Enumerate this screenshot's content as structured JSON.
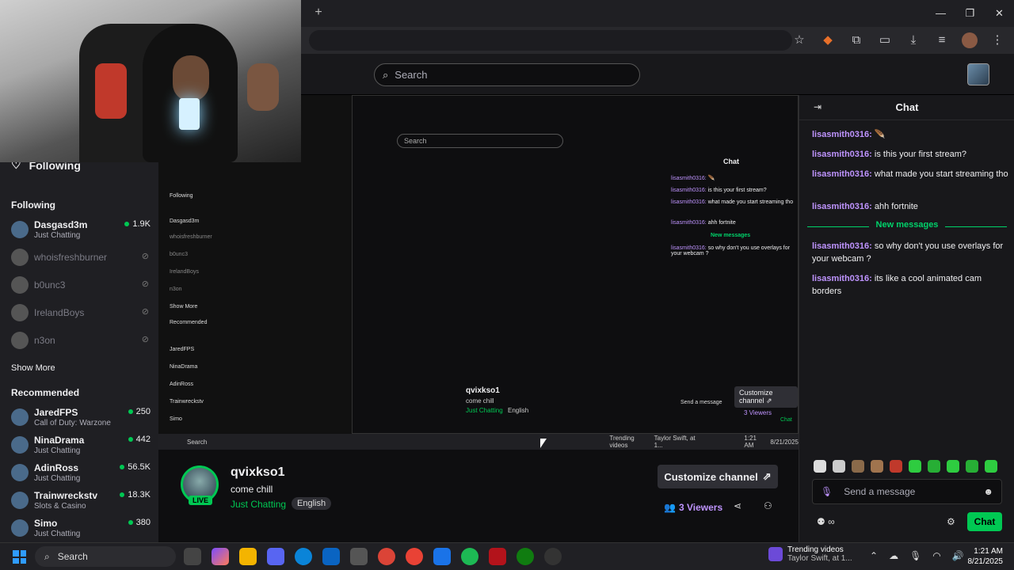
{
  "topnav": {
    "search_placeholder": "Search"
  },
  "sidebar": {
    "following_header": "Following",
    "following_section": "Following",
    "following": [
      {
        "name": "Dasgasd3m",
        "game": "Just Chatting",
        "viewers": "1.9K",
        "live": true
      },
      {
        "name": "whoisfreshburner",
        "live": false
      },
      {
        "name": "b0unc3",
        "live": false
      },
      {
        "name": "IrelandBoys",
        "live": false
      },
      {
        "name": "n3on",
        "live": false
      }
    ],
    "show_more": "Show More",
    "recommended_section": "Recommended",
    "recommended": [
      {
        "name": "JaredFPS",
        "game": "Call of Duty: Warzone",
        "viewers": "250"
      },
      {
        "name": "NinaDrama",
        "game": "Just Chatting",
        "viewers": "442"
      },
      {
        "name": "AdinRoss",
        "game": "Just Chatting",
        "viewers": "56.5K"
      },
      {
        "name": "Trainwreckstv",
        "game": "Slots & Casino",
        "viewers": "18.3K"
      },
      {
        "name": "Simo",
        "game": "Just Chatting",
        "viewers": "380"
      }
    ]
  },
  "nested": {
    "search": "Search",
    "chat_title": "Chat",
    "messages": [
      {
        "user": "lisasmith0316:",
        "text": "🪶"
      },
      {
        "user": "lisasmith0316:",
        "text": "is this your first stream?"
      },
      {
        "user": "lisasmith0316:",
        "text": "what made you start streaming tho"
      },
      {
        "user": "lisasmith0316:",
        "text": "ahh fortnite"
      }
    ],
    "new_messages": "New messages",
    "after": [
      {
        "user": "lisasmith0316:",
        "text": "so why don't you use overlays for your webcam ?"
      }
    ],
    "sidebar_head": "Following",
    "sidebar_items": [
      "Dasgasd3m",
      "whoisfreshburner",
      "b0unc3",
      "IrelandBoys",
      "n3on"
    ],
    "show_more": "Show More",
    "recommended": "Recommended",
    "rec_items": [
      "JaredFPS",
      "NinaDrama",
      "AdinRoss",
      "Trainwreckstv",
      "Simo"
    ],
    "channel_name": "qvixkso1",
    "channel_title": "come chill",
    "category": "Just Chatting",
    "language": "English",
    "customize": "Customize channel ⇗",
    "viewers": "3 Viewers",
    "send_message": "Send a message",
    "chat_button": "Chat",
    "taskbar_search": "Search",
    "trend1": "Trending videos",
    "trend2": "Taylor Swift, at 1...",
    "time": "1:21 AM",
    "date": "8/21/2025"
  },
  "channel": {
    "name": "qvixkso1",
    "title": "come chill",
    "category": "Just Chatting",
    "language": "English",
    "live_badge": "LIVE",
    "customize_label": "Customize channel",
    "viewers_count": "3",
    "viewers_label": "Viewers"
  },
  "chat": {
    "title": "Chat",
    "messages": [
      {
        "user": "lisasmith0316:",
        "text": "🪶"
      },
      {
        "user": "lisasmith0316:",
        "text": "is this your first stream?"
      },
      {
        "user": "lisasmith0316:",
        "text": "what made you start streaming tho"
      },
      {
        "user": "lisasmith0316:",
        "text": "ahh fortnite"
      }
    ],
    "new_messages_label": "New messages",
    "new_messages": [
      {
        "user": "lisasmith0316:",
        "text": "so why don't you use overlays for your webcam ?"
      },
      {
        "user": "lisasmith0316:",
        "text": "its like a cool animated cam borders"
      }
    ],
    "input_placeholder": "Send a message",
    "chat_button": "Chat"
  },
  "taskbar": {
    "search_label": "Search",
    "trending_title": "Trending videos",
    "trending_sub": "Taylor Swift, at 1...",
    "time": "1:21 AM",
    "date": "8/21/2025"
  },
  "colors": {
    "accent_purple": "#bf94ff",
    "live_green": "#00c853",
    "live_red": "#eb0400",
    "bg": "#0e0e10"
  }
}
